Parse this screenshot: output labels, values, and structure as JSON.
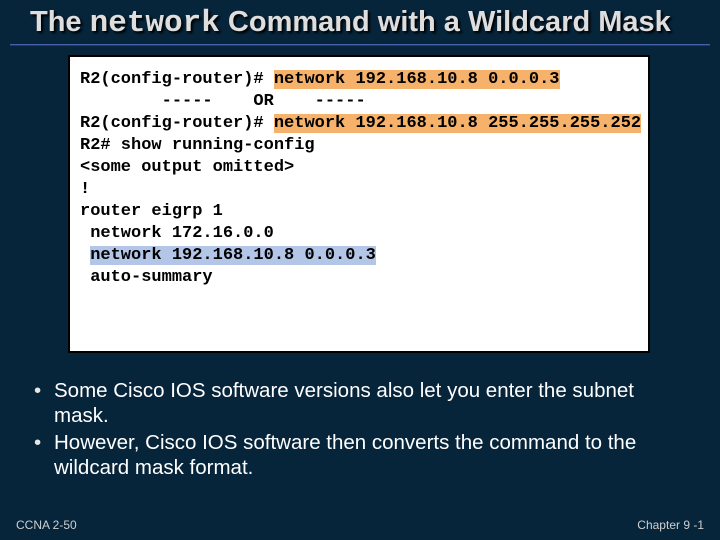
{
  "title": {
    "prefix": "The ",
    "mono": "network",
    "suffix": " Command with a Wildcard Mask"
  },
  "terminal": {
    "line1_a": "R2(config-router)# ",
    "line1_b": "network 192.168.10.8 0.0.0.3",
    "blank1": "",
    "line_or": "        -----    OR    -----",
    "blank2": "",
    "line3_a": "R2(config-router)# ",
    "line3_b": "network 192.168.10.8 255.255.255.252",
    "blank3": "",
    "line4": "R2# show running-config",
    "line5": "<some output omitted>",
    "line6": "!",
    "line7": "router eigrp 1",
    "line8": " network 172.16.0.0",
    "line9_a": " ",
    "line9_b": "network 192.168.10.8 0.0.0.3",
    "line10": " auto-summary"
  },
  "bullets": [
    "Some Cisco IOS software versions also let you enter the subnet mask.",
    "However, Cisco IOS software then converts the command to the wildcard mask format."
  ],
  "footer": {
    "left": "CCNA 2-50",
    "right": "Chapter  9 -1"
  }
}
